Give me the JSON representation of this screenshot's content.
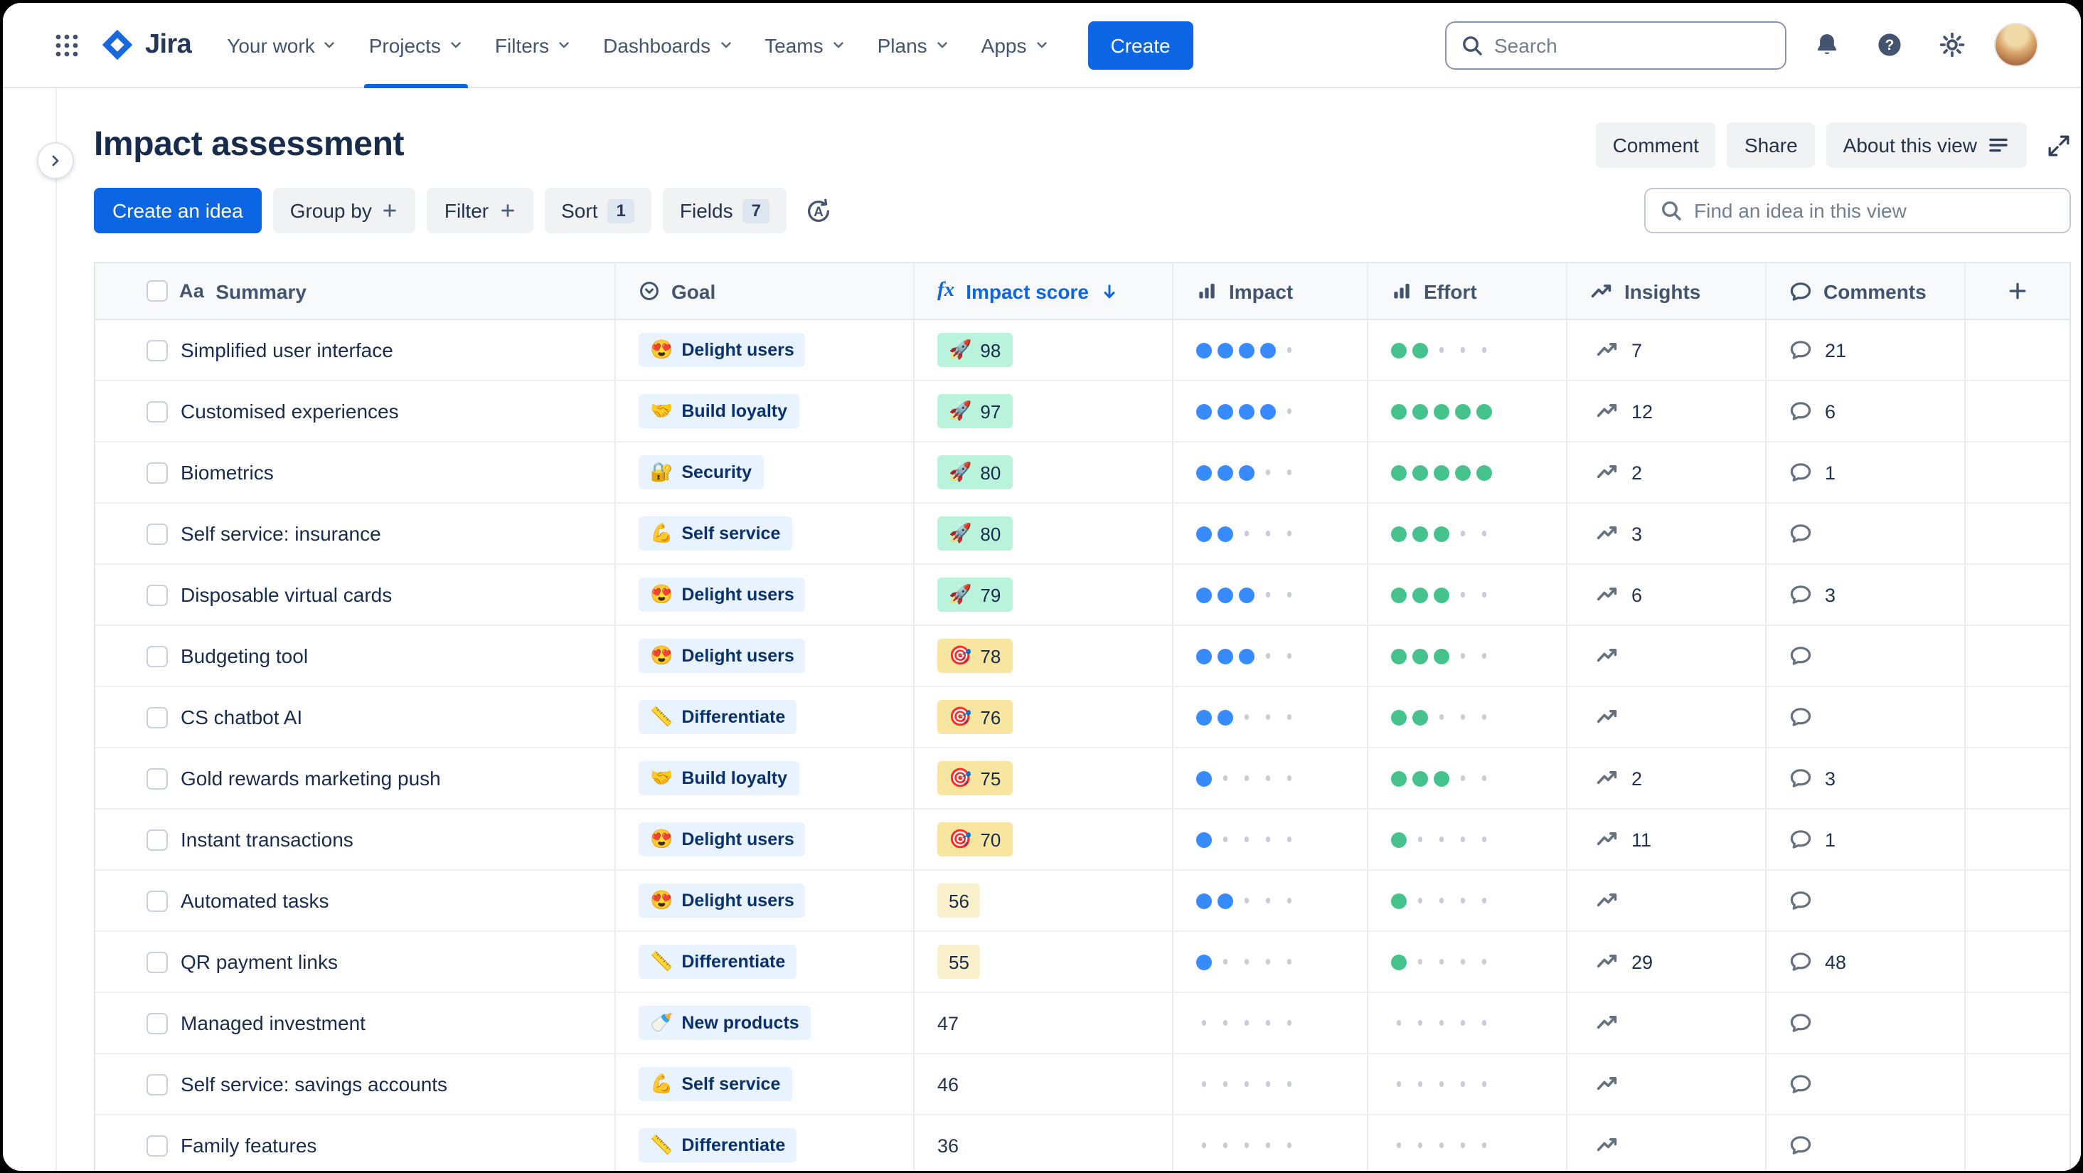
{
  "nav": {
    "logo_text": "Jira",
    "items": [
      {
        "label": "Your work",
        "active": false
      },
      {
        "label": "Projects",
        "active": true
      },
      {
        "label": "Filters",
        "active": false
      },
      {
        "label": "Dashboards",
        "active": false
      },
      {
        "label": "Teams",
        "active": false
      },
      {
        "label": "Plans",
        "active": false
      },
      {
        "label": "Apps",
        "active": false
      }
    ],
    "create_label": "Create",
    "search_placeholder": "Search"
  },
  "header": {
    "title": "Impact assessment",
    "actions": [
      {
        "label": "Comment",
        "icon": null
      },
      {
        "label": "Share",
        "icon": null
      },
      {
        "label": "About this view",
        "icon": "menu-lines-icon"
      }
    ]
  },
  "toolbar": {
    "create_idea_label": "Create an idea",
    "group_by_label": "Group by",
    "filter_label": "Filter",
    "sort_label": "Sort",
    "sort_count": "1",
    "fields_label": "Fields",
    "fields_count": "7",
    "find_placeholder": "Find an idea in this view"
  },
  "table": {
    "rating_max": 5,
    "columns": [
      {
        "key": "summary",
        "label": "Summary",
        "icon": "text-type-icon"
      },
      {
        "key": "goal",
        "label": "Goal",
        "icon": "goal-icon"
      },
      {
        "key": "score",
        "label": "Impact score",
        "icon": "formula-icon",
        "sorted": "desc"
      },
      {
        "key": "impact",
        "label": "Impact",
        "icon": "bar-chart-icon"
      },
      {
        "key": "effort",
        "label": "Effort",
        "icon": "bar-chart-icon"
      },
      {
        "key": "insights",
        "label": "Insights",
        "icon": "trend-icon"
      },
      {
        "key": "comments",
        "label": "Comments",
        "icon": "comment-icon"
      }
    ],
    "rows": [
      {
        "summary": "Simplified user interface",
        "goal": {
          "emoji": "😍",
          "label": "Delight users"
        },
        "score": {
          "value": "98",
          "emoji": "🚀",
          "tone": "green"
        },
        "impact": 4,
        "effort": 2,
        "insights": "7",
        "comments": "21"
      },
      {
        "summary": "Customised experiences",
        "goal": {
          "emoji": "🤝",
          "label": "Build loyalty"
        },
        "score": {
          "value": "97",
          "emoji": "🚀",
          "tone": "green"
        },
        "impact": 4,
        "effort": 5,
        "insights": "12",
        "comments": "6"
      },
      {
        "summary": "Biometrics",
        "goal": {
          "emoji": "🔐",
          "label": "Security"
        },
        "score": {
          "value": "80",
          "emoji": "🚀",
          "tone": "green"
        },
        "impact": 3,
        "effort": 5,
        "insights": "2",
        "comments": "1"
      },
      {
        "summary": "Self service: insurance",
        "goal": {
          "emoji": "💪",
          "label": "Self service"
        },
        "score": {
          "value": "80",
          "emoji": "🚀",
          "tone": "green"
        },
        "impact": 2,
        "effort": 3,
        "insights": "3",
        "comments": ""
      },
      {
        "summary": "Disposable virtual cards",
        "goal": {
          "emoji": "😍",
          "label": "Delight users"
        },
        "score": {
          "value": "79",
          "emoji": "🚀",
          "tone": "green"
        },
        "impact": 3,
        "effort": 3,
        "insights": "6",
        "comments": "3"
      },
      {
        "summary": "Budgeting tool",
        "goal": {
          "emoji": "😍",
          "label": "Delight users"
        },
        "score": {
          "value": "78",
          "emoji": "🎯",
          "tone": "yellow"
        },
        "impact": 3,
        "effort": 3,
        "insights": "",
        "comments": ""
      },
      {
        "summary": "CS chatbot AI",
        "goal": {
          "emoji": "📏",
          "label": "Differentiate"
        },
        "score": {
          "value": "76",
          "emoji": "🎯",
          "tone": "yellow"
        },
        "impact": 2,
        "effort": 2,
        "insights": "",
        "comments": ""
      },
      {
        "summary": "Gold rewards marketing push",
        "goal": {
          "emoji": "🤝",
          "label": "Build loyalty"
        },
        "score": {
          "value": "75",
          "emoji": "🎯",
          "tone": "yellow"
        },
        "impact": 1,
        "effort": 3,
        "insights": "2",
        "comments": "3"
      },
      {
        "summary": "Instant transactions",
        "goal": {
          "emoji": "😍",
          "label": "Delight users"
        },
        "score": {
          "value": "70",
          "emoji": "🎯",
          "tone": "yellow"
        },
        "impact": 1,
        "effort": 1,
        "insights": "11",
        "comments": "1"
      },
      {
        "summary": "Automated tasks",
        "goal": {
          "emoji": "😍",
          "label": "Delight users"
        },
        "score": {
          "value": "56",
          "emoji": "",
          "tone": "pale"
        },
        "impact": 2,
        "effort": 1,
        "insights": "",
        "comments": ""
      },
      {
        "summary": "QR payment links",
        "goal": {
          "emoji": "📏",
          "label": "Differentiate"
        },
        "score": {
          "value": "55",
          "emoji": "",
          "tone": "pale"
        },
        "impact": 1,
        "effort": 1,
        "insights": "29",
        "comments": "48"
      },
      {
        "summary": "Managed investment",
        "goal": {
          "emoji": "🍼",
          "label": "New products"
        },
        "score": {
          "value": "47",
          "emoji": "",
          "tone": "none"
        },
        "impact": 0,
        "effort": 0,
        "insights": "",
        "comments": ""
      },
      {
        "summary": "Self service: savings accounts",
        "goal": {
          "emoji": "💪",
          "label": "Self service"
        },
        "score": {
          "value": "46",
          "emoji": "",
          "tone": "none"
        },
        "impact": 0,
        "effort": 0,
        "insights": "",
        "comments": ""
      },
      {
        "summary": "Family features",
        "goal": {
          "emoji": "📏",
          "label": "Differentiate"
        },
        "score": {
          "value": "36",
          "emoji": "",
          "tone": "none"
        },
        "impact": 0,
        "effort": 0,
        "insights": "",
        "comments": ""
      }
    ]
  },
  "colors": {
    "accent": "#0C66E4",
    "impact_dot": "#388BFF",
    "effort_dot": "#46C28D",
    "score_green_bg": "#BAF3DB",
    "score_yellow_bg": "#F8E6A0",
    "score_pale_bg": "#FAF0CC",
    "goal_chip_bg": "#E9F2FF",
    "goal_chip_text": "#09326C"
  }
}
